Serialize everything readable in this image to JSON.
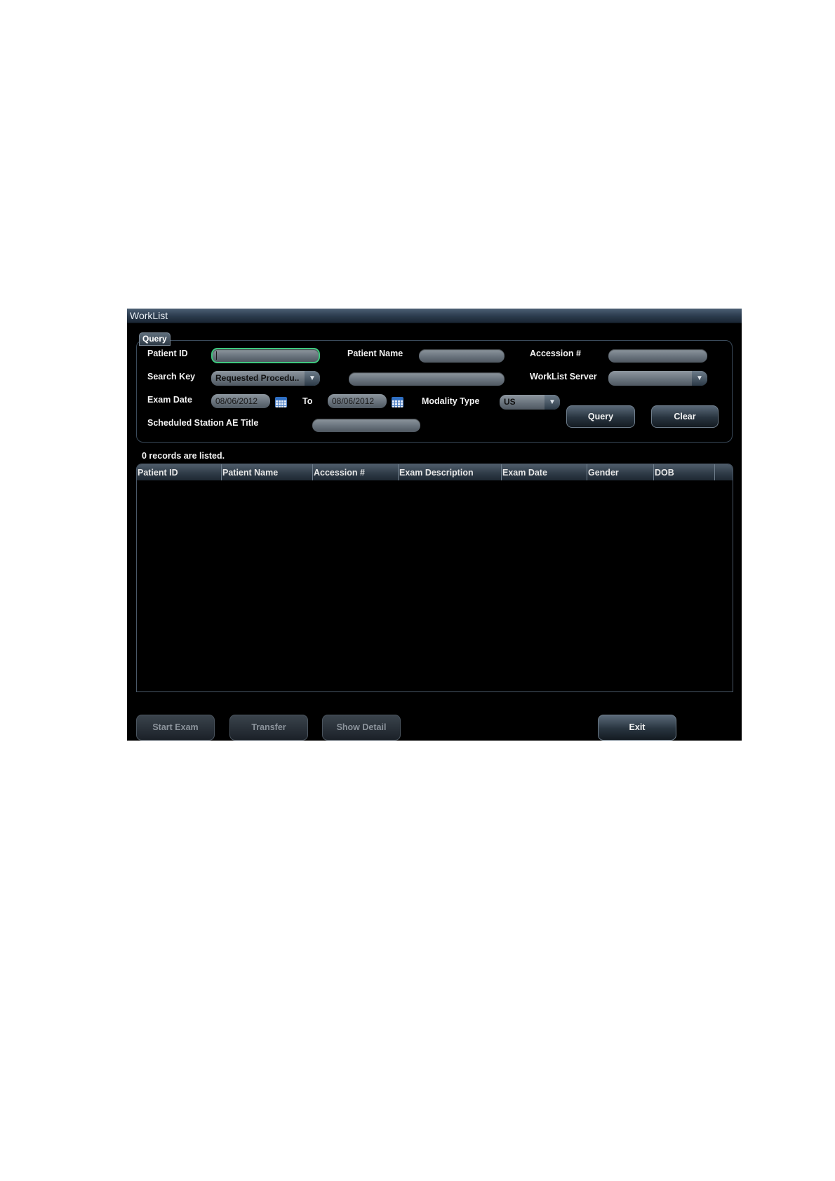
{
  "window": {
    "title": "WorkList"
  },
  "query": {
    "group_label": "Query",
    "patient_id": {
      "label": "Patient ID",
      "value": ""
    },
    "patient_name": {
      "label": "Patient Name",
      "value": ""
    },
    "accession": {
      "label": "Accession #",
      "value": ""
    },
    "search_key": {
      "label": "Search Key",
      "selected": "Requested Procedu..",
      "value": ""
    },
    "worklist_server": {
      "label": "WorkList Server",
      "selected": ""
    },
    "exam_date": {
      "label": "Exam Date",
      "from": "08/06/2012",
      "to_label": "To",
      "to": "08/06/2012"
    },
    "modality_type": {
      "label": "Modality Type",
      "selected": "US"
    },
    "scheduled_station": {
      "label": "Scheduled Station AE Title",
      "value": ""
    },
    "query_button": "Query",
    "clear_button": "Clear"
  },
  "results": {
    "status": "0 records are listed.",
    "columns": [
      "Patient ID",
      "Patient Name",
      "Accession #",
      "Exam Description",
      "Exam Date",
      "Gender",
      "DOB"
    ],
    "rows": []
  },
  "actions": {
    "start_exam": "Start Exam",
    "transfer": "Transfer",
    "show_detail": "Show Detail",
    "exit": "Exit"
  },
  "icons": {
    "calendar": "calendar-icon",
    "dropdown": "chevron-down-icon"
  },
  "colors": {
    "background": "#000000",
    "focus": "#3fc87f"
  }
}
